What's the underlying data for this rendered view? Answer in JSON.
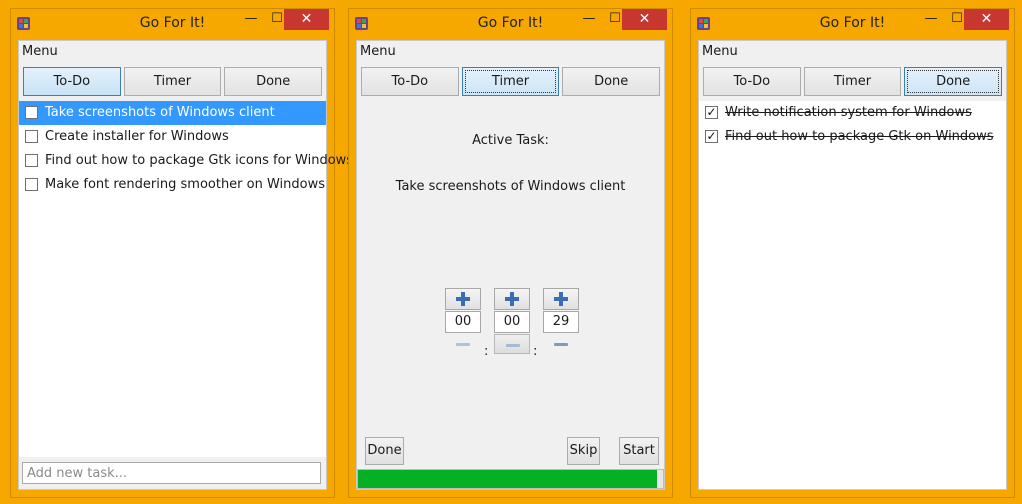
{
  "accent": "#3399ff",
  "close_color": "#c7372f",
  "progress_color": "#06b025",
  "windows": [
    {
      "title": "Go For It!",
      "menu": "Menu",
      "tabs": [
        "To-Do",
        "Timer",
        "Done"
      ],
      "active_tab": "To-Do",
      "tasks": [
        {
          "label": "Take screenshots of Windows client",
          "checked": false,
          "selected": true
        },
        {
          "label": "Create installer for Windows",
          "checked": false
        },
        {
          "label": "Find out how to package Gtk icons for Windows",
          "checked": false
        },
        {
          "label": "Make font rendering smoother on Windows",
          "checked": false
        }
      ],
      "add_placeholder": "Add new task..."
    },
    {
      "title": "Go For It!",
      "menu": "Menu",
      "tabs": [
        "To-Do",
        "Timer",
        "Done"
      ],
      "active_tab": "Timer",
      "active_task_label": "Active Task:",
      "active_task": "Take screenshots of Windows client",
      "timer": {
        "hours": "00",
        "minutes": "00",
        "seconds": "29",
        "separator": ":"
      },
      "buttons": {
        "done": "Done",
        "skip": "Skip",
        "start": "Start"
      },
      "progress": 0.98
    },
    {
      "title": "Go For It!",
      "menu": "Menu",
      "tabs": [
        "To-Do",
        "Timer",
        "Done"
      ],
      "active_tab": "Done",
      "done_tasks": [
        {
          "label": "Write notification system for Windows",
          "checked": true
        },
        {
          "label": "Find out how to package Gtk on Windows",
          "checked": true
        }
      ]
    }
  ],
  "icons": [
    "app-icon",
    "minimize-icon",
    "maximize-icon",
    "close-icon",
    "plus-icon",
    "minus-icon",
    "checkmark-icon"
  ],
  "glyphs": {
    "minimize": "—",
    "maximize": "☐",
    "close": "✕",
    "check": "✓"
  }
}
